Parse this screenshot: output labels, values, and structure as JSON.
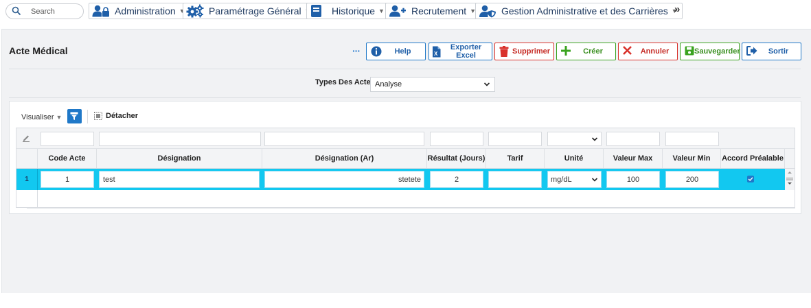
{
  "nav": {
    "search_placeholder": "Search",
    "items": [
      {
        "label": "Administration",
        "icon": "user-lock-icon"
      },
      {
        "label": "Paramétrage Général",
        "icon": "gears-icon"
      },
      {
        "label": "Historique",
        "icon": "book-icon"
      },
      {
        "label": "Recrutement",
        "icon": "user-plus-icon"
      },
      {
        "label": "Gestion Administrative et des Carrières",
        "icon": "user-shield-icon"
      }
    ],
    "more": "»"
  },
  "page": {
    "title": "Acte Médical",
    "more_dots": "···"
  },
  "toolbar": {
    "help": "Help",
    "export": "Exporter Excel",
    "delete": "Supprimer",
    "create": "Créer",
    "cancel": "Annuler",
    "save": "Sauvegarder",
    "exit": "Sortir"
  },
  "colors": {
    "help": "#1f78c8",
    "export": "#1f78c8",
    "delete": "#d9312b",
    "create": "#3aa31f",
    "cancel": "#d9312b",
    "save": "#3aa31f",
    "exit": "#1f78c8",
    "row_selected": "#12c8f0"
  },
  "filter": {
    "label": "Types Des Actes",
    "value": "Analyse"
  },
  "grid_toolbar": {
    "visualiser": "Visualiser",
    "detacher": "Détacher"
  },
  "table": {
    "columns": [
      "Code Acte",
      "Désignation",
      "Désignation (Ar)",
      "Résultat (Jours)",
      "Tarif",
      "Unité",
      "Valeur Max",
      "Valeur Min",
      "Accord Préalable"
    ],
    "rows": [
      {
        "num": "1",
        "code": "1",
        "designation": "test",
        "designation_ar": "stetete",
        "resultat": "2",
        "tarif": "",
        "unite": "mg/dL",
        "valeur_max": "100",
        "valeur_min": "200",
        "accord": true
      }
    ]
  }
}
